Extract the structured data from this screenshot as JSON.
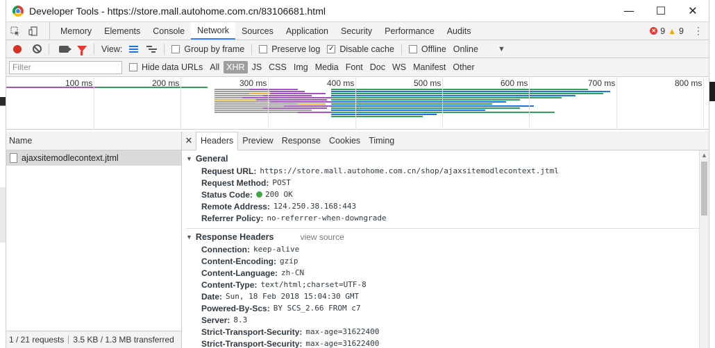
{
  "window": {
    "title": "Developer Tools - https://store.mall.autohome.com.cn/83106681.html",
    "controls": {
      "minimize": "—",
      "maximize": "☐",
      "close": "✕"
    }
  },
  "main_tabs": [
    "Memory",
    "Elements",
    "Console",
    "Network",
    "Sources",
    "Application",
    "Security",
    "Performance",
    "Audits"
  ],
  "active_tab": "Network",
  "counts": {
    "errors": "9",
    "warnings": "9"
  },
  "net_toolbar": {
    "view_label": "View:",
    "group_by_frame": "Group by frame",
    "preserve_log": "Preserve log",
    "disable_cache": "Disable cache",
    "offline": "Offline",
    "throttle": "Online"
  },
  "filter": {
    "placeholder": "Filter",
    "hide_data_urls": "Hide data URLs",
    "types": [
      "All",
      "XHR",
      "JS",
      "CSS",
      "Img",
      "Media",
      "Font",
      "Doc",
      "WS",
      "Manifest",
      "Other"
    ],
    "selected_type": "XHR"
  },
  "timeline": {
    "ticks": [
      "100 ms",
      "200 ms",
      "300 ms",
      "400 ms",
      "500 ms",
      "600 ms",
      "700 ms",
      "800 ms"
    ],
    "colors": {
      "blue": "#1a73e8",
      "green": "#2ca15a",
      "purple": "#a64fc7",
      "orange": "#f3b33d",
      "gray": "#9e9e9e"
    }
  },
  "left_pane": {
    "header": "Name",
    "rows": [
      "ajaxsitemodlecontext.jtml"
    ],
    "footer": {
      "requests": "1 / 21 requests",
      "transfer": "3.5 KB / 1.3 MB transferred"
    }
  },
  "detail_tabs": [
    "Headers",
    "Preview",
    "Response",
    "Cookies",
    "Timing"
  ],
  "active_detail_tab": "Headers",
  "general": {
    "title": "General",
    "rows": [
      {
        "key": "Request URL:",
        "value": "https://store.mall.autohome.com.cn/shop/ajaxsitemodlecontext.jtml"
      },
      {
        "key": "Request Method:",
        "value": "POST"
      },
      {
        "key": "Status Code:",
        "value": "200 OK"
      },
      {
        "key": "Remote Address:",
        "value": "124.250.38.168:443"
      },
      {
        "key": "Referrer Policy:",
        "value": "no-referrer-when-downgrade"
      }
    ]
  },
  "response_headers": {
    "title": "Response Headers",
    "view_source": "view source",
    "rows": [
      {
        "key": "Connection:",
        "value": "keep-alive"
      },
      {
        "key": "Content-Encoding:",
        "value": "gzip"
      },
      {
        "key": "Content-Language:",
        "value": "zh-CN"
      },
      {
        "key": "Content-Type:",
        "value": "text/html;charset=UTF-8"
      },
      {
        "key": "Date:",
        "value": "Sun, 18 Feb 2018 15:04:30 GMT"
      },
      {
        "key": "Powered-By-Scs:",
        "value": "BY SCS_2.66 FROM c7"
      },
      {
        "key": "Server:",
        "value": "8.3"
      },
      {
        "key": "Strict-Transport-Security:",
        "value": "max-age=31622400"
      },
      {
        "key": "Strict-Transport-Security:",
        "value": "max-age=31622400"
      }
    ]
  }
}
